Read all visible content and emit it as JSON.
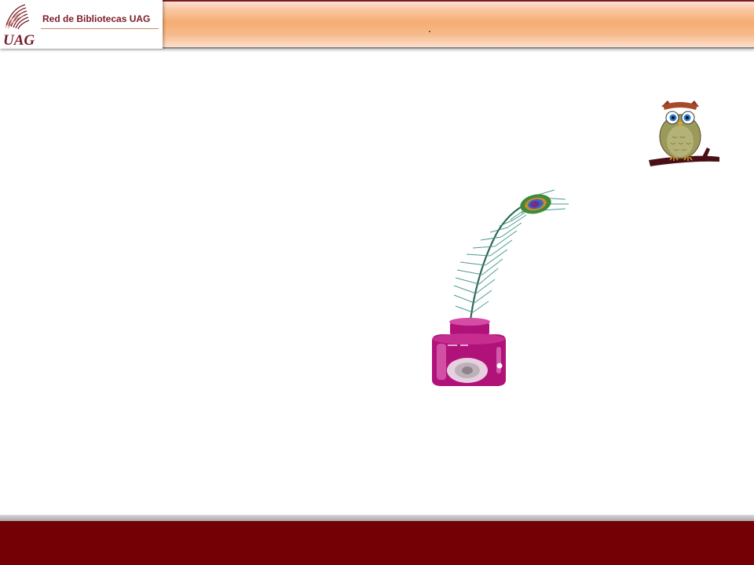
{
  "header": {
    "brand_logo_text": "UAG",
    "brand_title": "Red de Bibliotecas UAG",
    "slide_title": "."
  },
  "colors": {
    "brand_maroon": "#740006",
    "header_orange": "#f6ad72",
    "logo_text": "#7b1c2a"
  },
  "illustrations": {
    "owl": "owl-on-branch-clipart",
    "inkwell": "peacock-feather-in-pink-inkwell-clipart"
  }
}
